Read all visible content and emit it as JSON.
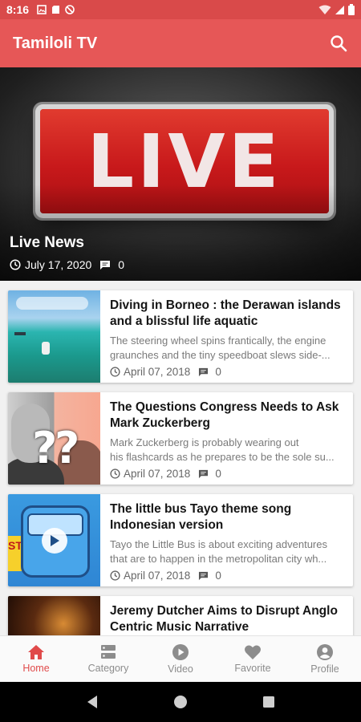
{
  "status_bar": {
    "time": "8:16"
  },
  "app": {
    "title": "Tamiloli TV"
  },
  "hero": {
    "sign_text": "LIVE",
    "title": "Live News",
    "date": "July 17, 2020",
    "comments": "0"
  },
  "cards": [
    {
      "title": "Diving in Borneo : the Derawan islands and a blissful life aquatic",
      "desc": "The steering wheel spins frantically, the engine\ngraunches and the tiny speedboat slews side-...",
      "date": "April 07, 2018",
      "comments": "0"
    },
    {
      "title": "The Questions Congress Needs to Ask Mark Zuckerberg",
      "desc": "Mark Zuckerberg is probably wearing out\nhis flashcards as he prepares to be the sole su...",
      "date": "April 07, 2018",
      "comments": "0"
    },
    {
      "title": "The little bus Tayo theme song Indonesian version",
      "desc": "Tayo the Little Bus is about exciting adventures\nthat are to happen in the metropolitan city wh...",
      "date": "April 07, 2018",
      "comments": "0"
    },
    {
      "title": "Jeremy Dutcher Aims to Disrupt Anglo Centric Music Narrative",
      "desc": "",
      "date": "",
      "comments": ""
    }
  ],
  "thumb_text": {
    "tayo_sign": "ST"
  },
  "bottom_nav": [
    {
      "label": "Home",
      "icon": "home-icon",
      "active": true
    },
    {
      "label": "Category",
      "icon": "category-icon",
      "active": false
    },
    {
      "label": "Video",
      "icon": "play-circle-icon",
      "active": false
    },
    {
      "label": "Favorite",
      "icon": "heart-icon",
      "active": false
    },
    {
      "label": "Profile",
      "icon": "account-circle-icon",
      "active": false
    }
  ],
  "colors": {
    "primary": "#e65757",
    "status_bar": "#d94a4a",
    "active_nav": "#e04a4a"
  }
}
